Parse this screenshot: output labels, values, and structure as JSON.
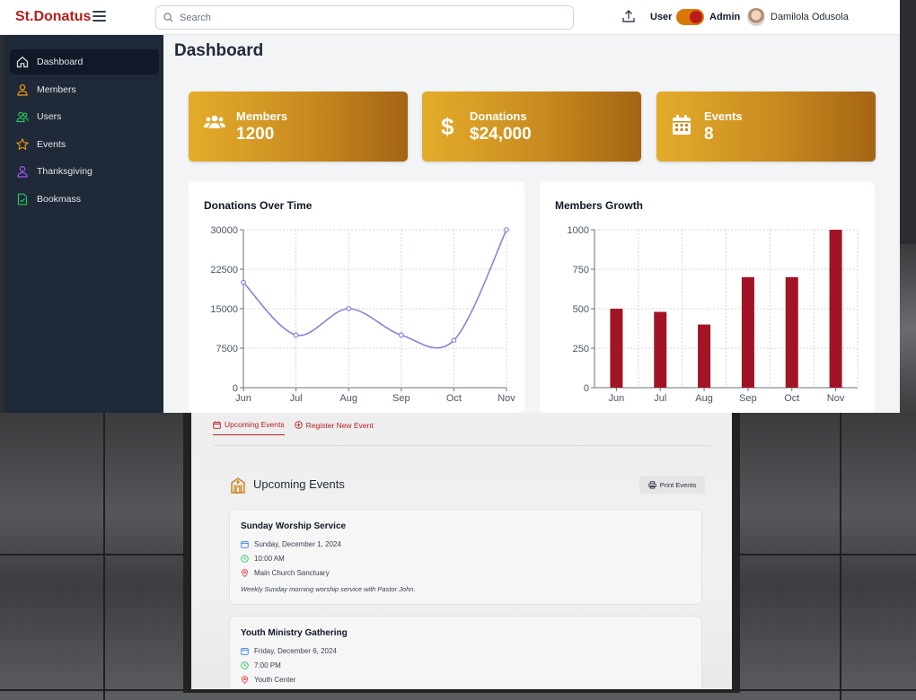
{
  "app": {
    "name": "St.Donatus"
  },
  "search": {
    "placeholder": "Search"
  },
  "header": {
    "role_user": "User",
    "role_admin": "Admin",
    "username": "Damilola Odusola"
  },
  "sidebar": {
    "items": [
      {
        "label": "Dashboard",
        "icon": "home-icon",
        "active": true
      },
      {
        "label": "Members",
        "icon": "person-icon",
        "color": "#f59e0b"
      },
      {
        "label": "Users",
        "icon": "users-icon",
        "color": "#22c55e"
      },
      {
        "label": "Events",
        "icon": "star-icon",
        "color": "#f59e0b"
      },
      {
        "label": "Thanksgiving",
        "icon": "person-icon",
        "color": "#a855f7"
      },
      {
        "label": "Bookmass",
        "icon": "document-icon",
        "color": "#22c55e"
      }
    ]
  },
  "dashboard": {
    "title": "Dashboard",
    "stats": [
      {
        "label": "Members",
        "value": "1200",
        "icon": "group-icon"
      },
      {
        "label": "Donations",
        "value": "$24,000",
        "icon": "dollar-icon"
      },
      {
        "label": "Events",
        "value": "8",
        "icon": "calendar-icon"
      }
    ],
    "accent": "#b91c1c",
    "card_gradient": [
      "#e3ad2b",
      "#a56414"
    ]
  },
  "chart_data": [
    {
      "type": "line",
      "title": "Donations Over Time",
      "categories": [
        "Jun",
        "Jul",
        "Aug",
        "Sep",
        "Oct",
        "Nov"
      ],
      "values": [
        20000,
        10000,
        15000,
        10000,
        9000,
        30000
      ],
      "yticks": [
        "0",
        "7500",
        "15000",
        "22500",
        "30000"
      ],
      "ylim": [
        0,
        30000
      ],
      "grid": true,
      "color": "#8b80d6"
    },
    {
      "type": "bar",
      "title": "Members Growth",
      "categories": [
        "Jun",
        "Jul",
        "Aug",
        "Sep",
        "Oct",
        "Nov"
      ],
      "values": [
        500,
        480,
        400,
        700,
        700,
        1000
      ],
      "yticks": [
        "0",
        "250",
        "500",
        "750",
        "1000"
      ],
      "ylim": [
        0,
        1000
      ],
      "grid": true,
      "color": "#a01426"
    }
  ],
  "events": {
    "tabs": [
      {
        "label": "Upcoming Events",
        "icon": "calendar-icon",
        "active": true
      },
      {
        "label": "Register New Event",
        "icon": "plus-circle-icon",
        "active": false
      }
    ],
    "heading": "Upcoming Events",
    "print_label": "Print Events",
    "items": [
      {
        "title": "Sunday Worship Service",
        "date": "Sunday, December 1, 2024",
        "time": "10:00 AM",
        "location": "Main Church Sanctuary",
        "description": "Weekly Sunday morning worship service with Pastor John."
      },
      {
        "title": "Youth Ministry Gathering",
        "date": "Friday, December 6, 2024",
        "time": "7:00 PM",
        "location": "Youth Center"
      }
    ]
  }
}
